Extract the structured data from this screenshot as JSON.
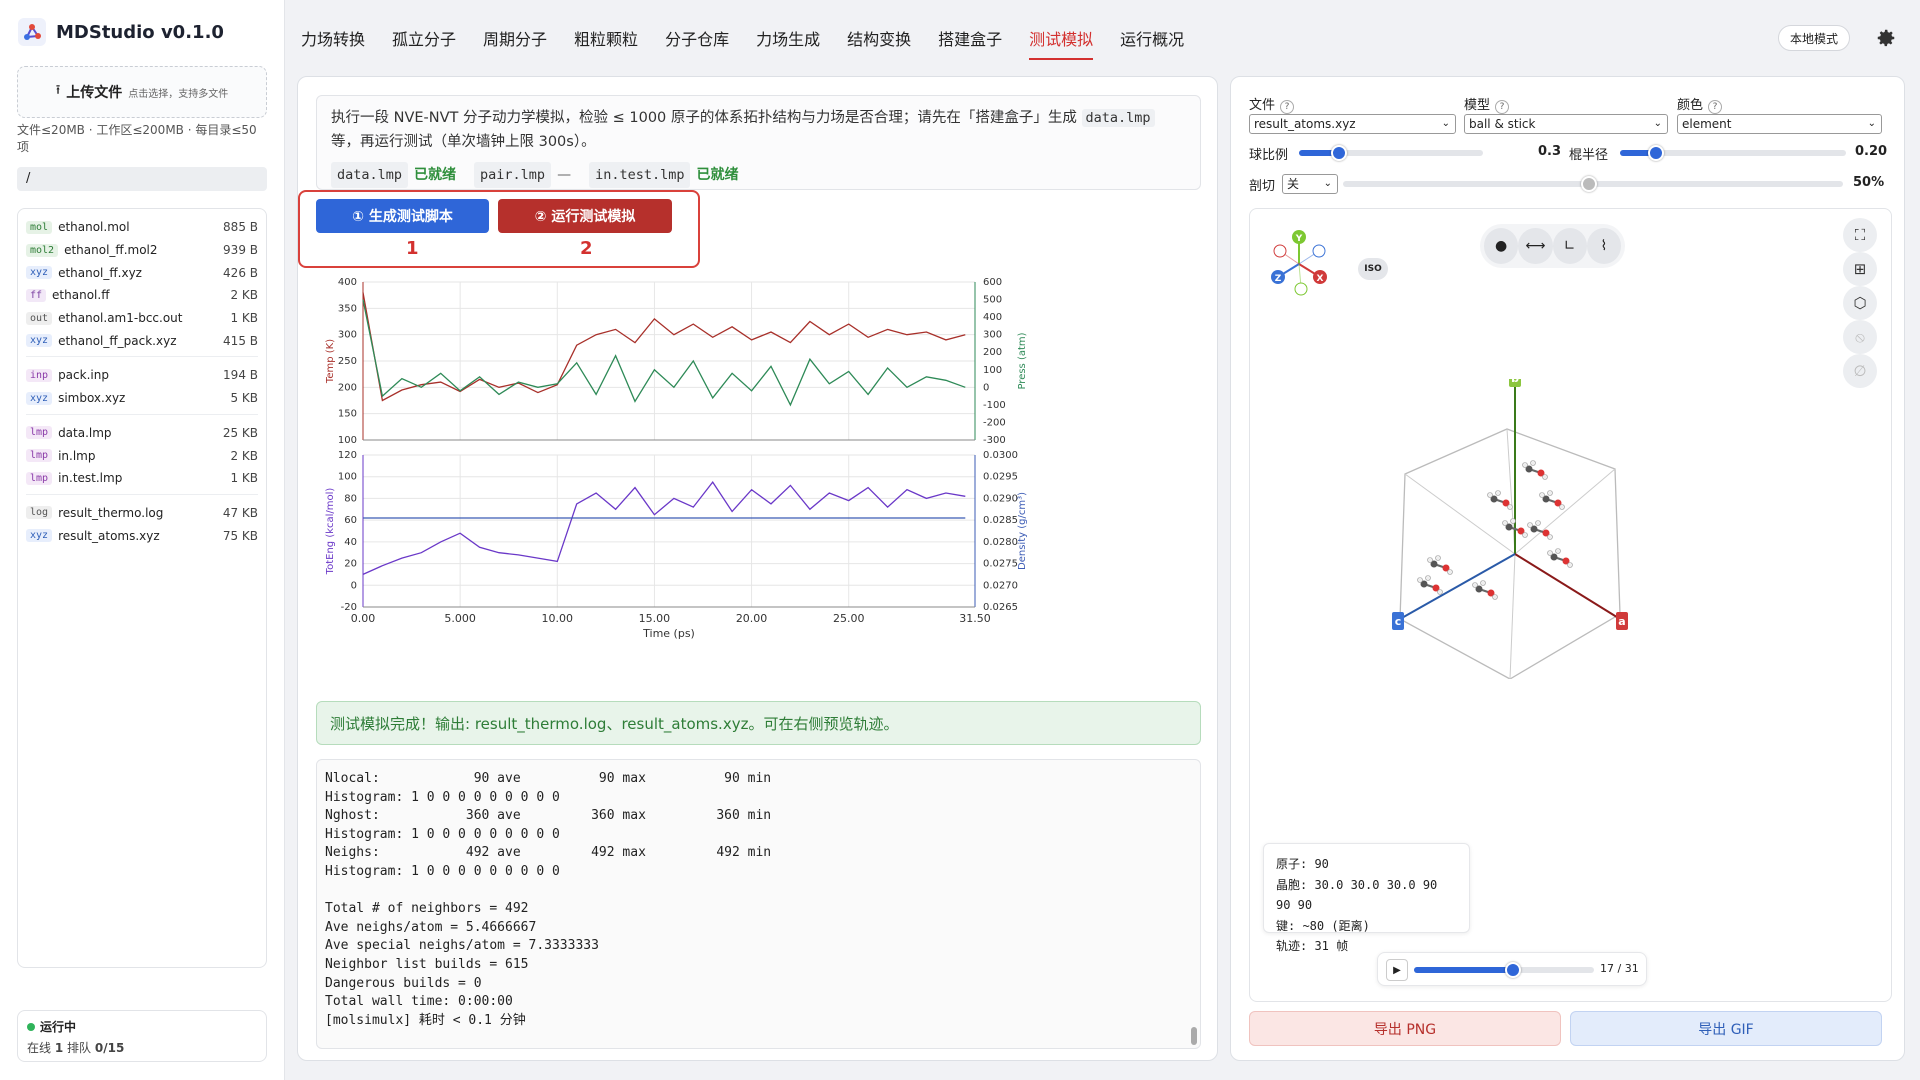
{
  "app": {
    "name": "MDStudio",
    "version": "v0.1.0"
  },
  "sidebar": {
    "upload_label": "上传文件",
    "upload_hint": "点击选择，支持多文件",
    "limits": "文件≤20MB · 工作区≤200MB · 每目录≤50项",
    "path": "/",
    "file_groups": [
      [
        {
          "tag": "mol",
          "name": "ethanol.mol",
          "size": "885 B",
          "color": "#e6f2e6",
          "tagtext": "#2e7d37"
        },
        {
          "tag": "mol2",
          "name": "ethanol_ff.mol2",
          "size": "939 B",
          "color": "#e6f2e6",
          "tagtext": "#2e7d37"
        },
        {
          "tag": "xyz",
          "name": "ethanol_ff.xyz",
          "size": "426 B",
          "color": "#e7eefc",
          "tagtext": "#2f5fb8"
        },
        {
          "tag": "ff",
          "name": "ethanol.ff",
          "size": "2 KB",
          "color": "#f2e8f7",
          "tagtext": "#7a3ea0"
        },
        {
          "tag": "out",
          "name": "ethanol.am1-bcc.out",
          "size": "1 KB",
          "color": "#eeeeee",
          "tagtext": "#555555"
        },
        {
          "tag": "xyz",
          "name": "ethanol_ff_pack.xyz",
          "size": "415 B",
          "color": "#e7eefc",
          "tagtext": "#2f5fb8"
        }
      ],
      [
        {
          "tag": "inp",
          "name": "pack.inp",
          "size": "194 B",
          "color": "#f4e8f7",
          "tagtext": "#8a3aa8"
        },
        {
          "tag": "xyz",
          "name": "simbox.xyz",
          "size": "5 KB",
          "color": "#e7eefc",
          "tagtext": "#2f5fb8"
        }
      ],
      [
        {
          "tag": "lmp",
          "name": "data.lmp",
          "size": "25 KB",
          "color": "#f4e8f7",
          "tagtext": "#8a3aa8"
        },
        {
          "tag": "lmp",
          "name": "in.lmp",
          "size": "2 KB",
          "color": "#f4e8f7",
          "tagtext": "#8a3aa8"
        },
        {
          "tag": "lmp",
          "name": "in.test.lmp",
          "size": "1 KB",
          "color": "#f4e8f7",
          "tagtext": "#8a3aa8"
        }
      ],
      [
        {
          "tag": "log",
          "name": "result_thermo.log",
          "size": "47 KB",
          "color": "#eeeeee",
          "tagtext": "#555555"
        },
        {
          "tag": "xyz",
          "name": "result_atoms.xyz",
          "size": "75 KB",
          "color": "#e7eefc",
          "tagtext": "#2f5fb8"
        }
      ]
    ],
    "status": {
      "label": "运行中",
      "online_label": "在线",
      "online": "1",
      "queue_label": "排队",
      "queue": "0/15"
    }
  },
  "nav": {
    "tabs": [
      "力场转换",
      "孤立分子",
      "周期分子",
      "粗粒颗粒",
      "分子仓库",
      "力场生成",
      "结构变换",
      "搭建盒子",
      "测试模拟",
      "运行概况"
    ],
    "active_index": 8,
    "local_mode": "本地模式"
  },
  "main": {
    "desc_part1": "执行一段 NVE-NVT 分子动力学模拟，检验 ≤ 1000 原子的体系拓扑结构与力场是否合理；请先在「搭建盒子」生成",
    "desc_code": "data.lmp",
    "desc_part2": "等，再运行测试（单次墙钟上限 300s）。",
    "files": [
      {
        "name": "data.lmp",
        "state": "已就绪",
        "ready": true
      },
      {
        "name": "pair.lmp",
        "state": "—",
        "ready": false
      },
      {
        "name": "in.test.lmp",
        "state": "已就绪",
        "ready": true
      }
    ],
    "btn_generate": "① 生成测试脚本",
    "btn_run": "② 运行测试模拟",
    "marker1": "1",
    "marker2": "2",
    "success": "测试模拟完成！输出: result_thermo.log、result_atoms.xyz。可在右侧预览轨迹。",
    "log_lines": [
      "Nlocal:            90 ave          90 max          90 min",
      "Histogram: 1 0 0 0 0 0 0 0 0 0",
      "Nghost:           360 ave         360 max         360 min",
      "Histogram: 1 0 0 0 0 0 0 0 0 0",
      "Neighs:           492 ave         492 max         492 min",
      "Histogram: 1 0 0 0 0 0 0 0 0 0",
      "",
      "Total # of neighbors = 492",
      "Ave neighs/atom = 5.4666667",
      "Ave special neighs/atom = 7.3333333",
      "Neighbor list builds = 615",
      "Dangerous builds = 0",
      "Total wall time: 0:00:00",
      "[molsimulx] 耗时 < 0.1 分钟"
    ]
  },
  "chart_data": [
    {
      "type": "line",
      "ylabel": "Temp (K)",
      "y2label": "Press (atm)",
      "ylim": [
        100,
        400
      ],
      "y2lim": [
        -300,
        600
      ],
      "yticks": [
        100,
        150,
        200,
        250,
        300,
        350,
        400
      ],
      "y2ticks": [
        -300,
        -200,
        -100,
        0,
        100,
        200,
        300,
        400,
        500,
        600
      ],
      "xlim": [
        0,
        31.5
      ],
      "series": [
        {
          "name": "Temp (K)",
          "axis": "left",
          "color": "#a8302a",
          "x": [
            0,
            1,
            2,
            3,
            4,
            5,
            6,
            7,
            8,
            9,
            10,
            11,
            12,
            13,
            14,
            15,
            16,
            17,
            18,
            19,
            20,
            21,
            22,
            23,
            24,
            25,
            26,
            27,
            28,
            29,
            30,
            31
          ],
          "y": [
            380,
            175,
            195,
            205,
            210,
            192,
            215,
            200,
            208,
            190,
            205,
            280,
            300,
            310,
            285,
            330,
            300,
            320,
            295,
            315,
            290,
            305,
            285,
            325,
            300,
            320,
            295,
            310,
            300,
            305,
            290,
            300
          ]
        },
        {
          "name": "Press (atm)",
          "axis": "right",
          "color": "#2e8a57",
          "x": [
            0,
            1,
            2,
            3,
            4,
            5,
            6,
            7,
            8,
            9,
            10,
            11,
            12,
            13,
            14,
            15,
            16,
            17,
            18,
            19,
            20,
            21,
            22,
            23,
            24,
            25,
            26,
            27,
            28,
            29,
            30,
            31
          ],
          "y": [
            500,
            -50,
            50,
            0,
            80,
            -20,
            60,
            -40,
            30,
            0,
            20,
            140,
            -40,
            180,
            -80,
            100,
            0,
            150,
            -60,
            80,
            -20,
            120,
            -100,
            160,
            20,
            90,
            -40,
            110,
            0,
            60,
            40,
            0
          ]
        }
      ]
    },
    {
      "type": "line",
      "xlabel": "Time (ps)",
      "ylabel": "TotEng (kcal/mol)",
      "y2label": "Density (g/cm³)",
      "ylim": [
        -20,
        120
      ],
      "y2lim": [
        0.0265,
        0.03
      ],
      "yticks": [
        -20,
        0,
        20,
        40,
        60,
        80,
        100,
        120
      ],
      "y2ticks": [
        "0.0265",
        "0.0270",
        "0.0275",
        "0.0280",
        "0.0285",
        "0.0290",
        "0.0295",
        "0.0300"
      ],
      "xticks": [
        "0.00",
        "5.000",
        "10.00",
        "15.00",
        "20.00",
        "25.00",
        "31.50"
      ],
      "xlim": [
        0,
        31.5
      ],
      "series": [
        {
          "name": "TotEng (kcal/mol)",
          "axis": "left",
          "color": "#6a38c8",
          "x": [
            0,
            1,
            2,
            3,
            4,
            5,
            6,
            7,
            8,
            9,
            10,
            11,
            12,
            13,
            14,
            15,
            16,
            17,
            18,
            19,
            20,
            21,
            22,
            23,
            24,
            25,
            26,
            27,
            28,
            29,
            30,
            31
          ],
          "y": [
            10,
            18,
            25,
            30,
            40,
            48,
            35,
            30,
            28,
            25,
            22,
            75,
            85,
            70,
            90,
            65,
            80,
            72,
            95,
            68,
            88,
            75,
            92,
            70,
            85,
            78,
            90,
            72,
            88,
            80,
            85,
            82
          ]
        },
        {
          "name": "Density (g/cm³)",
          "axis": "right",
          "color": "#3b5bb5",
          "x": [
            0,
            31
          ],
          "y": [
            0.02855,
            0.02855
          ]
        }
      ]
    }
  ],
  "right": {
    "file_label": "文件",
    "file_value": "result_atoms.xyz",
    "model_label": "模型",
    "model_value": "ball & stick",
    "color_label": "颜色",
    "color_value": "element",
    "ball_label": "球比例",
    "ball_value": "0.3",
    "stick_label": "棍半径",
    "stick_value": "0.20",
    "cut_label": "剖切",
    "cut_value": "关",
    "cut_percent": "50%",
    "iso": "ISO",
    "axis_labels": {
      "a": "a",
      "b": "b",
      "c": "c"
    },
    "info": {
      "atoms": "原子: 90",
      "cell": "晶胞: 30.0 30.0 30.0 90 90 90",
      "bonds": "键: ~80 (距离)",
      "traj": "轨迹: 31 帧"
    },
    "frame": "17 / 31",
    "frame_fraction": 0.548,
    "export_png": "导出 PNG",
    "export_gif": "导出 GIF"
  }
}
